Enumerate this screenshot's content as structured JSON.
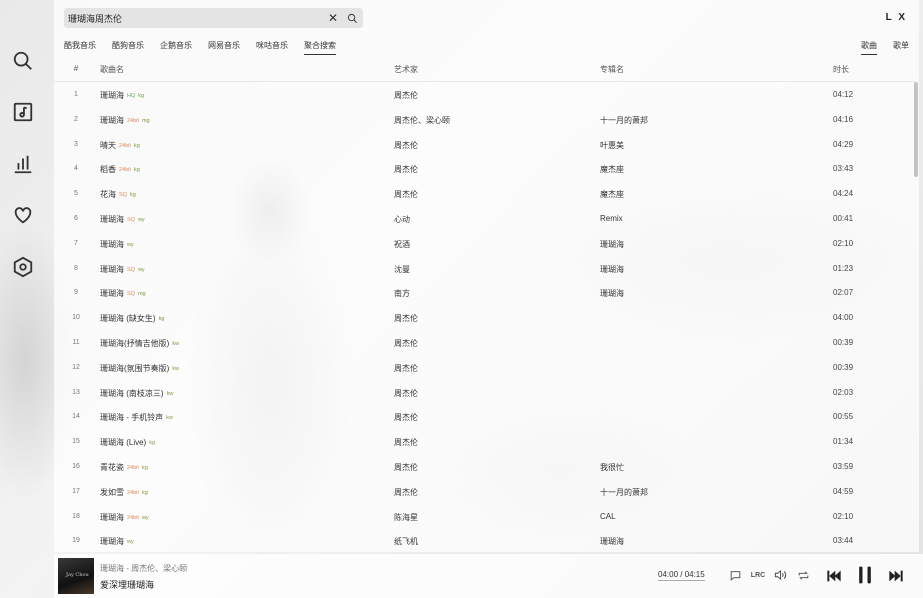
{
  "app": {
    "brand": "L X"
  },
  "sidebar": {
    "items": [
      {
        "name": "search",
        "icon": "search-icon"
      },
      {
        "name": "song-list",
        "icon": "music-note-icon"
      },
      {
        "name": "leaderboard",
        "icon": "bar-chart-icon"
      },
      {
        "name": "my-list",
        "icon": "heart-icon"
      },
      {
        "name": "settings",
        "icon": "settings-icon"
      }
    ]
  },
  "search": {
    "value": "珊瑚海周杰伦",
    "placeholder": ""
  },
  "sources": [
    "酷我音乐",
    "酷狗音乐",
    "企鹅音乐",
    "网易音乐",
    "咪咕音乐",
    "聚合搜索"
  ],
  "active_source": 5,
  "types": [
    "歌曲",
    "歌单"
  ],
  "active_type": 0,
  "table": {
    "headers": {
      "num": "#",
      "name": "歌曲名",
      "artist": "艺术家",
      "album": "专辑名",
      "duration": "时长"
    },
    "rows": [
      {
        "num": "1",
        "name": "珊瑚海",
        "q": "HQ",
        "src": "kg",
        "artist": "周杰伦",
        "album": "",
        "dur": "04:12"
      },
      {
        "num": "2",
        "name": "珊瑚海",
        "q": "24bit",
        "src": "mg",
        "artist": "周杰伦、梁心颐",
        "album": "十一月的萧邦",
        "dur": "04:16"
      },
      {
        "num": "3",
        "name": "晴天",
        "q": "24bit",
        "src": "kg",
        "artist": "周杰伦",
        "album": "叶惠美",
        "dur": "04:29"
      },
      {
        "num": "4",
        "name": "稻香",
        "q": "24bit",
        "src": "kg",
        "artist": "周杰伦",
        "album": "魔杰座",
        "dur": "03:43"
      },
      {
        "num": "5",
        "name": "花海",
        "q": "SQ",
        "src": "kg",
        "artist": "周杰伦",
        "album": "魔杰座",
        "dur": "04:24"
      },
      {
        "num": "6",
        "name": "珊瑚海",
        "q": "SQ",
        "src": "wy",
        "artist": "心动",
        "album": "Remix",
        "dur": "00:41"
      },
      {
        "num": "7",
        "name": "珊瑚海",
        "q": "",
        "src": "wy",
        "artist": "祝酒",
        "album": "珊瑚海",
        "dur": "02:10"
      },
      {
        "num": "8",
        "name": "珊瑚海",
        "q": "SQ",
        "src": "wy",
        "artist": "沈曼",
        "album": "珊瑚海",
        "dur": "01:23"
      },
      {
        "num": "9",
        "name": "珊瑚海",
        "q": "SQ",
        "src": "mg",
        "artist": "南方",
        "album": "珊瑚海",
        "dur": "02:07"
      },
      {
        "num": "10",
        "name": "珊瑚海 (缺女生)",
        "q": "",
        "src": "kg",
        "artist": "周杰伦",
        "album": "",
        "dur": "04:00"
      },
      {
        "num": "11",
        "name": "珊瑚海(抒情吉他版)",
        "q": "",
        "src": "kw",
        "artist": "周杰伦",
        "album": "",
        "dur": "00:39"
      },
      {
        "num": "12",
        "name": "珊瑚海(氛围节奏版)",
        "q": "",
        "src": "kw",
        "artist": "周杰伦",
        "album": "",
        "dur": "00:39"
      },
      {
        "num": "13",
        "name": "珊瑚海 (南枝凉三)",
        "q": "",
        "src": "kw",
        "artist": "周杰伦",
        "album": "",
        "dur": "02:03"
      },
      {
        "num": "14",
        "name": "珊瑚海 - 手机铃声",
        "q": "",
        "src": "kw",
        "artist": "周杰伦",
        "album": "",
        "dur": "00:55"
      },
      {
        "num": "15",
        "name": "珊瑚海 (Live)",
        "q": "",
        "src": "kg",
        "artist": "周杰伦",
        "album": "",
        "dur": "01:34"
      },
      {
        "num": "16",
        "name": "青花瓷",
        "q": "24bit",
        "src": "kg",
        "artist": "周杰伦",
        "album": "我很忙",
        "dur": "03:59"
      },
      {
        "num": "17",
        "name": "发如雪",
        "q": "24bit",
        "src": "kg",
        "artist": "周杰伦",
        "album": "十一月的萧邦",
        "dur": "04:59"
      },
      {
        "num": "18",
        "name": "珊瑚海",
        "q": "24bit",
        "src": "wy",
        "artist": "陈海星",
        "album": "CAL",
        "dur": "02:10"
      },
      {
        "num": "19",
        "name": "珊瑚海",
        "q": "",
        "src": "wy",
        "artist": "纸飞机",
        "album": "珊瑚海",
        "dur": "03:44"
      }
    ]
  },
  "player": {
    "cover_text": "Jay Chou",
    "artist_line": "珊瑚海 - 周杰伦、梁心颐",
    "lyric": "爱深埋珊瑚海",
    "time": "04:00 / 04:15",
    "lrc_label": "LRC"
  }
}
